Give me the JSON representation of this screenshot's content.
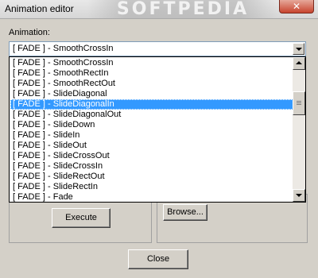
{
  "window": {
    "title": "Animation editor",
    "watermark": "SOFTPEDIA"
  },
  "animation": {
    "label": "Animation:",
    "selected": "[ FADE ] - SmoothCrossIn",
    "options": [
      "[ FADE ] - SmoothCrossIn",
      "[ FADE ] - SmoothRectIn",
      "[ FADE ] - SmoothRectOut",
      "[ FADE ] - SlideDiagonal",
      "[ FADE ] - SlideDiagonalIn",
      "[ FADE ] - SlideDiagonalOut",
      "[ FADE ] - SlideDown",
      "[ FADE ] - SlideIn",
      "[ FADE ] - SlideOut",
      "[ FADE ] - SlideCrossOut",
      "[ FADE ] - SlideCrossIn",
      "[ FADE ] - SlideRectOut",
      "[ FADE ] - SlideRectIn",
      "[ FADE ] - Fade"
    ],
    "highlighted_index": 4
  },
  "buttons": {
    "execute": "Execute",
    "browse": "Browse...",
    "close": "Close"
  },
  "icons": {
    "close": "close-icon",
    "combo_arrow": "chevron-down-icon",
    "scroll_up": "arrow-up-icon",
    "scroll_down": "arrow-down-icon"
  },
  "colors": {
    "selection": "#3399ff",
    "dialog": "#d4d0c8",
    "close_button": "#c7442e"
  }
}
